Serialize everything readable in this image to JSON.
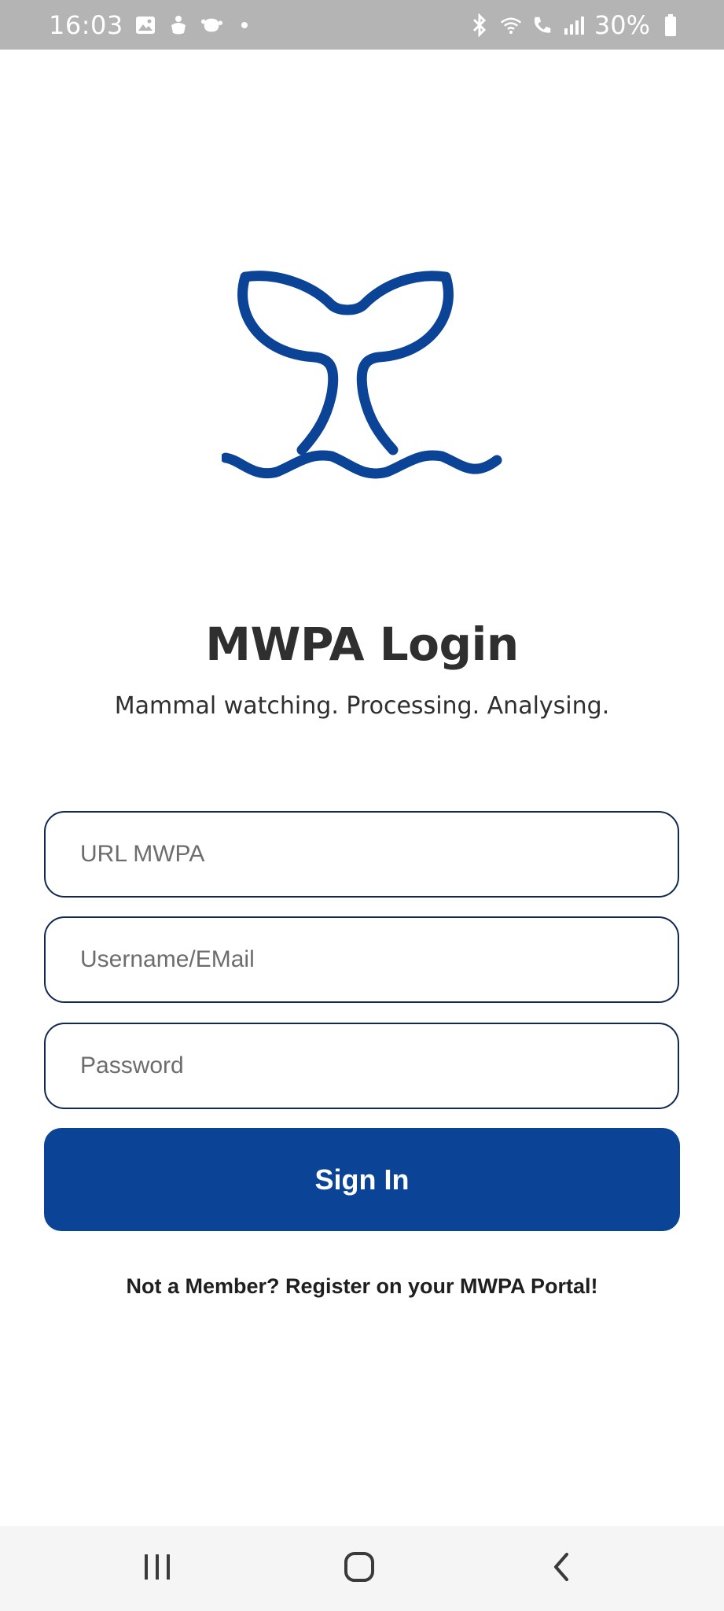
{
  "status_bar": {
    "time": "16:03",
    "battery": "30%",
    "icons": [
      "gallery-icon",
      "app-icon",
      "app-icon-2",
      "dot-icon",
      "bluetooth-icon",
      "wifi-icon",
      "call-icon",
      "signal-icon",
      "battery-icon"
    ]
  },
  "login": {
    "title": "MWPA Login",
    "subtitle": "Mammal watching. Processing. Analysing.",
    "url_placeholder": "URL MWPA",
    "username_placeholder": "Username/EMail",
    "password_placeholder": "Password",
    "signin_label": "Sign In",
    "register_text": "Not a Member? Register on your MWPA Portal!"
  },
  "colors": {
    "brand": "#0b4496",
    "field_border": "#10284f",
    "status_bar": "#b4b4b4"
  },
  "nav_bar": {
    "buttons": [
      "recent-apps-icon",
      "home-icon",
      "back-icon"
    ]
  }
}
